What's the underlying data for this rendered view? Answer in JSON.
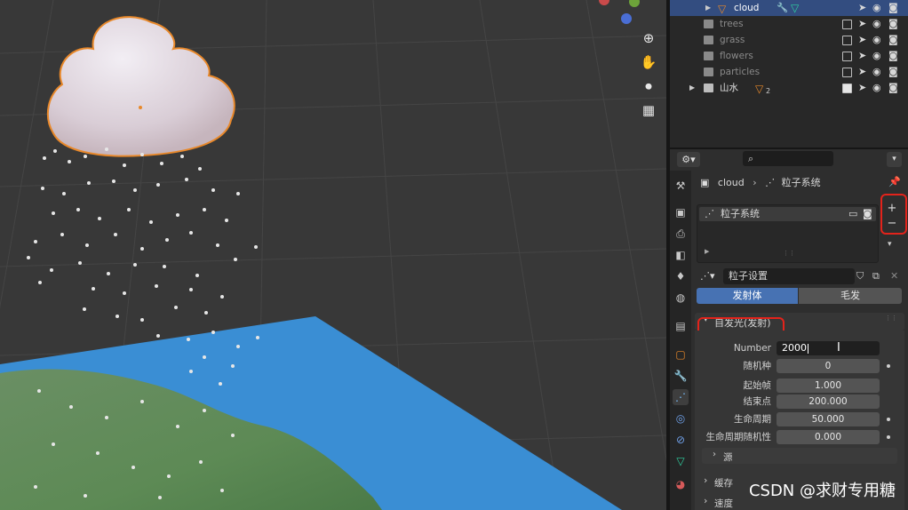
{
  "outliner": {
    "rows": [
      {
        "label": "cloud"
      },
      {
        "label": "trees"
      },
      {
        "label": "grass"
      },
      {
        "label": "flowers"
      },
      {
        "label": "particles"
      },
      {
        "label": "山水",
        "badge": "2"
      }
    ]
  },
  "properties": {
    "breadcrumb": {
      "object": "cloud",
      "system": "粒子系统"
    },
    "particle_list": [
      {
        "label": "粒子系统"
      }
    ],
    "settings_name": "粒子设置",
    "type_tabs": {
      "emitter": "发射体",
      "hair": "毛发"
    },
    "panel_title": "自发光(发射)",
    "fields": [
      {
        "label": "Number",
        "value": "2000"
      },
      {
        "label": "随机种",
        "value": "0"
      },
      {
        "label": "起始帧",
        "value": "1.000"
      },
      {
        "label": "结束点",
        "value": "200.000"
      },
      {
        "label": "生命周期",
        "value": "50.000"
      },
      {
        "label": "生命周期随机性",
        "value": "0.000"
      }
    ],
    "subpanels": [
      {
        "label": "源"
      },
      {
        "label": "缓存"
      },
      {
        "label": "速度"
      }
    ]
  },
  "watermark": "CSDN @求财专用糖",
  "colors": {
    "selection": "#334d80",
    "accent": "#4772b3",
    "highlight": "#e3231b",
    "water": "#3a8ed4"
  }
}
